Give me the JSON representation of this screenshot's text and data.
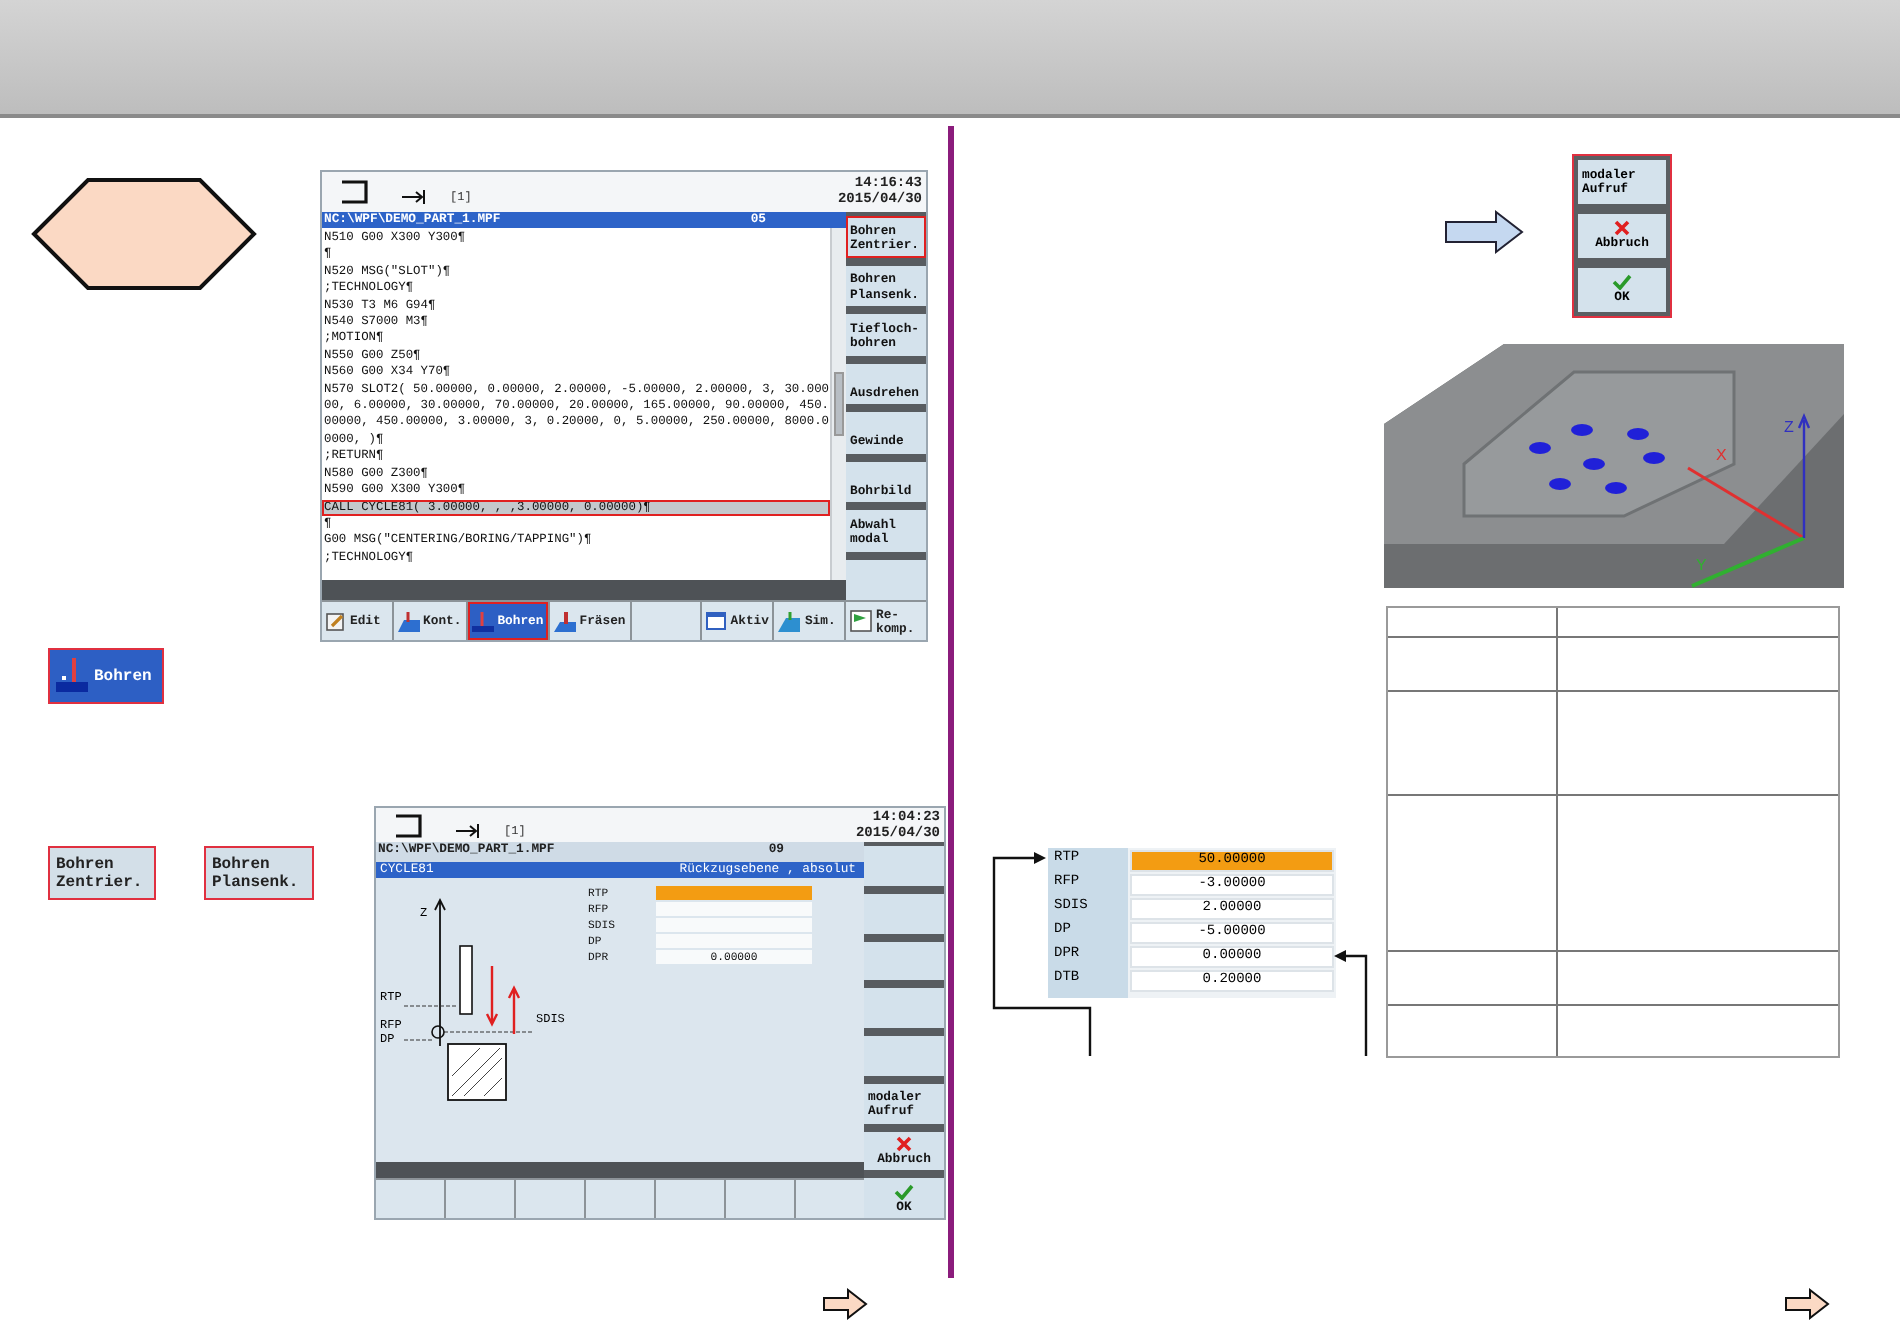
{
  "program_screen": {
    "kind": "editor",
    "channel_marker": "[1]",
    "time": "14:16:43",
    "date": "2015/04/30",
    "path": "NC:\\WPF\\DEMO_PART_1.MPF",
    "channel": "05",
    "lines": [
      {
        "text": "N510 G00 X300 Y300¶",
        "selected": false
      },
      {
        "text": "¶",
        "selected": false
      },
      {
        "text": "N520 MSG(\"SLOT\")¶",
        "selected": false
      },
      {
        "text": ";TECHNOLOGY¶",
        "selected": false
      },
      {
        "text": "N530 T3 M6 G94¶",
        "selected": false
      },
      {
        "text": "N540 S7000 M3¶",
        "selected": false
      },
      {
        "text": ";MOTION¶",
        "selected": false
      },
      {
        "text": "N550 G00 Z50¶",
        "selected": false
      },
      {
        "text": "N560 G00 X34 Y70¶",
        "selected": false
      },
      {
        "text": "N570 SLOT2( 50.00000, 0.00000, 2.00000, -5.00000, 2.00000, 3, 30.000",
        "selected": false
      },
      {
        "text": "00, 6.00000, 30.00000, 70.00000, 20.00000, 165.00000, 90.00000, 450.",
        "selected": false
      },
      {
        "text": "00000, 450.00000, 3.00000, 3, 0.20000, 0, 5.00000, 250.00000, 8000.0",
        "selected": false
      },
      {
        "text": "0000, )¶",
        "selected": false
      },
      {
        "text": ";RETURN¶",
        "selected": false
      },
      {
        "text": "N580 G00 Z300¶",
        "selected": false
      },
      {
        "text": "N590 G00 X300 Y300¶",
        "selected": false
      },
      {
        "text": "CALL CYCLE81( 3.00000, , ,3.00000, 0.00000)¶",
        "selected": true
      },
      {
        "text": "¶",
        "selected": false
      },
      {
        "text": "G00 MSG(\"CENTERING/BORING/TAPPING\")¶",
        "selected": false
      },
      {
        "text": ";TECHNOLOGY¶",
        "selected": false
      }
    ],
    "vertical_softkeys": [
      {
        "label": "Bohren\nZentrier.",
        "selected": true
      },
      {
        "label": "Bohren\nPlansenk.",
        "selected": false
      },
      {
        "label": "Tiefloch-\nbohren",
        "selected": false
      },
      {
        "label": "Ausdrehen",
        "selected": false
      },
      {
        "label": "Gewinde",
        "selected": false
      },
      {
        "label": "Bohrbild",
        "selected": false
      },
      {
        "label": "Abwahl\nmodal",
        "selected": false
      },
      {
        "selected": false
      }
    ],
    "horizontal_softkeys": [
      {
        "label": "Edit",
        "selected": false
      },
      {
        "label": "Kont.",
        "selected": false
      },
      {
        "label": "Bohren",
        "selected": true
      },
      {
        "label": "Fräsen",
        "selected": false
      },
      {
        "selected": false
      },
      {
        "label": "Aktiv",
        "selected": false
      },
      {
        "label": "Sim.",
        "selected": false
      },
      {
        "label": "Re-\nkomp.",
        "selected": false
      }
    ]
  },
  "softkey_callouts": [
    {
      "kind": "icon",
      "label": "Bohren"
    },
    {
      "kind": "text",
      "label": "Bohren\nZentrier."
    },
    {
      "kind": "text",
      "label": "Bohren\nPlansenk."
    }
  ],
  "cycle_screen": {
    "kind": "form",
    "channel_marker": "[1]",
    "time": "14:04:23",
    "date": "2015/04/30",
    "path": "NC:\\WPF\\DEMO_PART_1.MPF",
    "channel": "09",
    "title": "CYCLE81",
    "hint": "Rückzugsebene , absolut",
    "fields": [
      {
        "name": "RTP",
        "selected": true
      },
      {
        "name": "RFP",
        "selected": false
      },
      {
        "name": "SDIS",
        "selected": false
      },
      {
        "name": "DP",
        "selected": false
      },
      {
        "name": "DPR",
        "value": "0.00000",
        "selected": false
      }
    ],
    "diagram_labels": {
      "z": "Z",
      "rtp": "RTP",
      "rfp": "RFP",
      "dp": "DP",
      "sdis": "SDIS"
    },
    "vertical_softkeys": [
      {
        "label": "modaler\nAufruf"
      },
      {
        "label": "Abbruch"
      },
      {
        "label": "OK"
      }
    ]
  },
  "modal_panel": {
    "softkeys": [
      {
        "label": "modaler\nAufruf"
      },
      {
        "label": "Abbruch"
      },
      {
        "label": "OK"
      }
    ]
  },
  "part_render": {
    "axes": [
      {
        "label": "X",
        "color": "#e03030"
      },
      {
        "label": "Y",
        "color": "#30b030"
      },
      {
        "label": "Z",
        "color": "#3030c0"
      }
    ]
  },
  "parameters": [
    {
      "name": "RTP",
      "value": "50.00000",
      "selected": true
    },
    {
      "name": "RFP",
      "value": "-3.00000",
      "selected": false
    },
    {
      "name": "SDIS",
      "value": "2.00000",
      "selected": false
    },
    {
      "name": "DP",
      "value": "-5.00000",
      "selected": false
    },
    {
      "name": "DPR",
      "value": "0.00000",
      "selected": false
    },
    {
      "name": "DTB",
      "value": "0.20000",
      "selected": false
    }
  ]
}
